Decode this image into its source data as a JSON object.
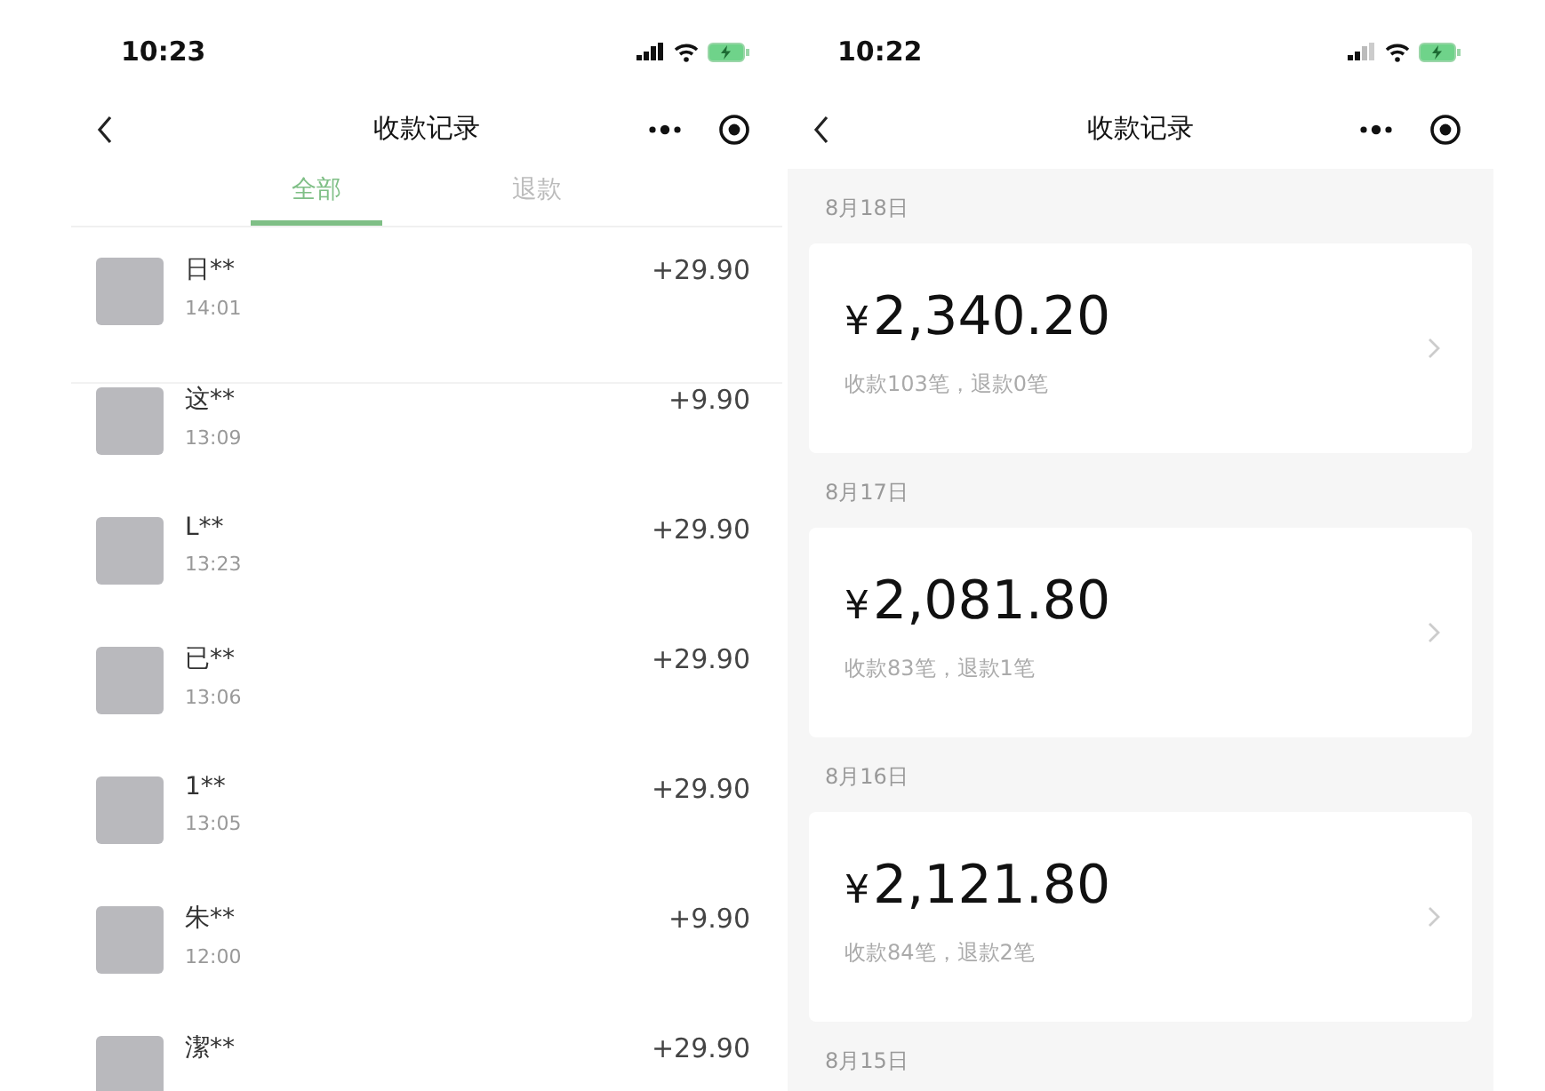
{
  "left_screen": {
    "status_bar": {
      "time": "10:23"
    },
    "nav_bar": {
      "title": "收款记录"
    },
    "tabs": [
      {
        "label": "全部",
        "selected": true
      },
      {
        "label": "退款",
        "selected": false
      }
    ],
    "payments": [
      {
        "name": "日**",
        "time": "14:01",
        "amount": "+29.90"
      },
      {
        "name": "这**",
        "time": "13:09",
        "amount": "+9.90"
      },
      {
        "name": "L**",
        "time": "13:23",
        "amount": "+29.90"
      },
      {
        "name": "已**",
        "time": "13:06",
        "amount": "+29.90"
      },
      {
        "name": "1**",
        "time": "13:05",
        "amount": "+29.90"
      },
      {
        "name": "朱**",
        "time": "12:00",
        "amount": "+9.90"
      },
      {
        "name": "潔**",
        "amount": "+29.90"
      }
    ]
  },
  "right_screen": {
    "status_bar": {
      "time": "10:22"
    },
    "nav_bar": {
      "title": "收款记录"
    },
    "days": [
      {
        "date": "8月18日",
        "currency": "¥",
        "total": "2,340.20",
        "summary": "收款103笔，退款0笔"
      },
      {
        "date": "8月17日",
        "currency": "¥",
        "total": "2,081.80",
        "summary": "收款83笔，退款1笔"
      },
      {
        "date": "8月16日",
        "currency": "¥",
        "total": "2,121.80",
        "summary": "收款84笔，退款2笔"
      },
      {
        "date": "8月15日"
      }
    ]
  }
}
